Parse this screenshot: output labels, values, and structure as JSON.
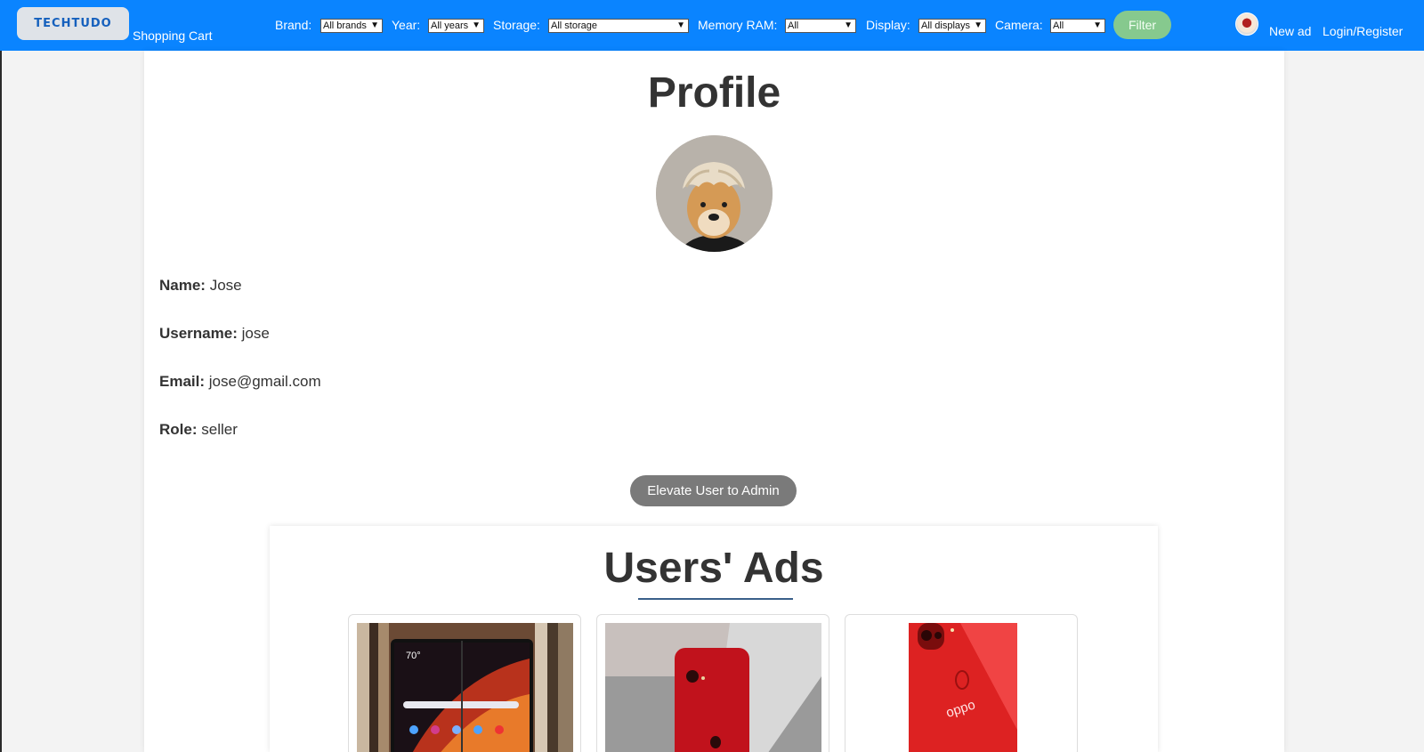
{
  "navbar": {
    "logo": "TECHTUDO",
    "cart_label": "Shopping Cart",
    "filters": [
      {
        "label": "Brand:",
        "selected": "All brands"
      },
      {
        "label": "Year:",
        "selected": "All years"
      },
      {
        "label": "Storage:",
        "selected": "All storage"
      },
      {
        "label": "Memory RAM:",
        "selected": "All"
      },
      {
        "label": "Display:",
        "selected": "All displays"
      },
      {
        "label": "Camera:",
        "selected": "All"
      }
    ],
    "filter_button": "Filter",
    "new_ad": "New ad",
    "login": "Login/Register"
  },
  "profile": {
    "title": "Profile",
    "name_label": "Name:",
    "name": "Jose",
    "username_label": "Username:",
    "username": "jose",
    "email_label": "Email:",
    "email": "jose@gmail.com",
    "role_label": "Role:",
    "role": "seller",
    "elevate_button": "Elevate User to Admin"
  },
  "ads": {
    "title": "Users' Ads",
    "items": [
      {
        "image": "foldable-phone-image"
      },
      {
        "image": "red-iphone-image"
      },
      {
        "image": "red-oppo-phone-image",
        "brand_text": "oppo"
      }
    ]
  },
  "colors": {
    "navbar": "#0a84ff",
    "filter_button": "#86c98e",
    "elevate_button": "#7a7a7a",
    "underline": "#3a5f8a"
  }
}
